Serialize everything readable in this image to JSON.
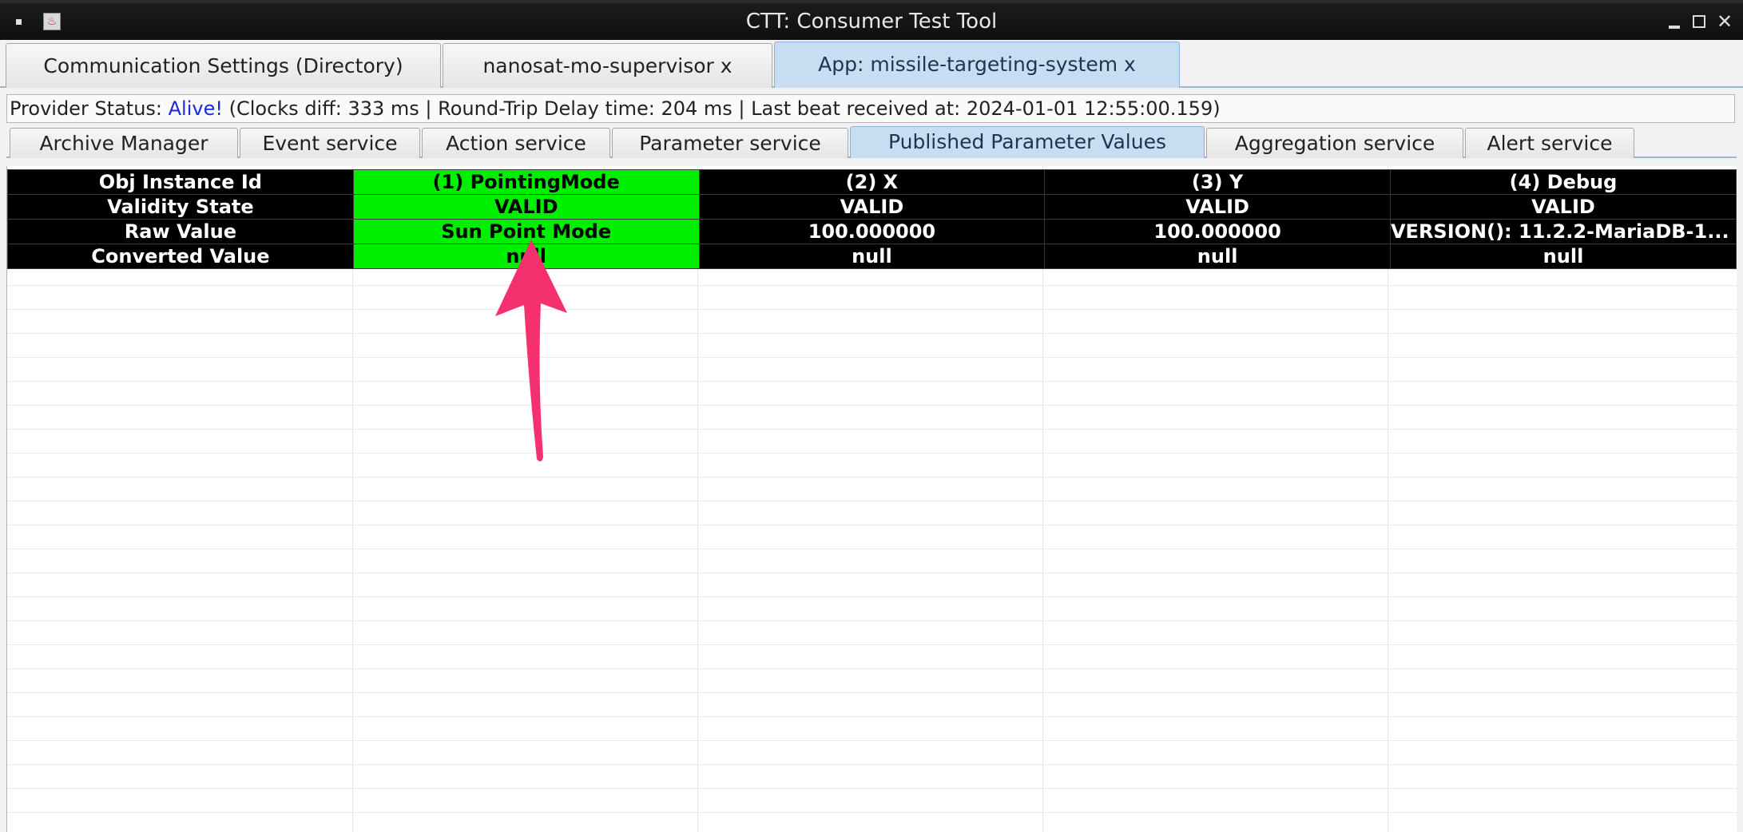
{
  "window": {
    "title": "CTT: Consumer Test Tool"
  },
  "main_tabs": [
    {
      "label": "Communication Settings (Directory)",
      "active": false
    },
    {
      "label": "nanosat-mo-supervisor x",
      "active": false
    },
    {
      "label": "App: missile-targeting-system x",
      "active": true
    }
  ],
  "status": {
    "prefix": "Provider Status: ",
    "state": "Alive!",
    "details": " (Clocks diff: 333 ms | Round-Trip Delay time: 204 ms | Last beat received at: 2024-01-01 12:55:00.159)"
  },
  "sub_tabs": [
    {
      "label": "Archive Manager",
      "active": false
    },
    {
      "label": "Event service",
      "active": false
    },
    {
      "label": "Action service",
      "active": false
    },
    {
      "label": "Parameter service",
      "active": false
    },
    {
      "label": "Published Parameter Values",
      "active": true
    },
    {
      "label": "Aggregation service",
      "active": false
    },
    {
      "label": "Alert service",
      "active": false
    }
  ],
  "table": {
    "rows": [
      [
        "Obj Instance Id",
        "(1) PointingMode",
        "(2) X",
        "(3) Y",
        "(4) Debug"
      ],
      [
        "Validity State",
        "VALID",
        "VALID",
        "VALID",
        "VALID"
      ],
      [
        "Raw Value",
        "Sun Point Mode",
        "100.000000",
        "100.000000",
        "VERSION(): 11.2.2-MariaDB-1..."
      ],
      [
        "Converted Value",
        "null",
        "null",
        "null",
        "null"
      ]
    ],
    "highlight_color": "#00ee00"
  },
  "annotation": {
    "arrow_color": "#f4306e"
  }
}
